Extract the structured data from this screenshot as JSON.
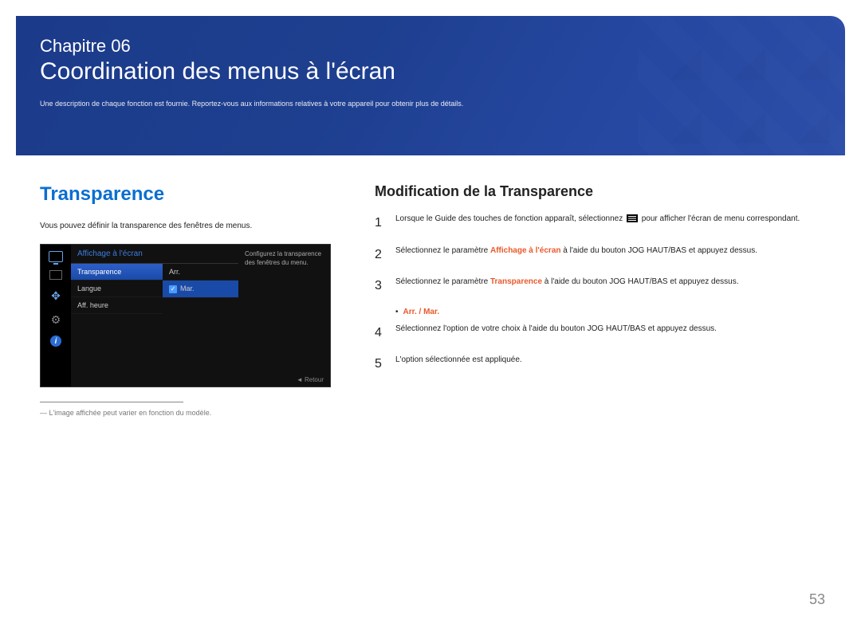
{
  "header": {
    "chapter_label": "Chapitre 06",
    "title": "Coordination des menus à l'écran",
    "desc": "Une description de chaque fonction est fournie. Reportez-vous aux informations relatives à votre appareil pour obtenir plus de détails."
  },
  "left": {
    "section_title": "Transparence",
    "section_desc": "Vous pouvez définir la transparence des fenêtres de menus.",
    "osd": {
      "head": "Affichage à l'écran",
      "items": [
        "Transparence",
        "Langue",
        "Aff. heure"
      ],
      "options": [
        "Arr.",
        "Mar."
      ],
      "info": "Configurez la transparence des fenêtres du menu.",
      "return": "Retour"
    },
    "footnote": "L'image affichée peut varier en fonction du modèle."
  },
  "right": {
    "sub_title": "Modification de la Transparence",
    "steps": [
      {
        "num": "1",
        "pre": "Lorsque le Guide des touches de fonction apparaît, sélectionnez ",
        "icon": true,
        "post": " pour afficher l'écran de menu correspondant."
      },
      {
        "num": "2",
        "pre": "Sélectionnez le paramètre ",
        "hl": "Affichage à l'écran",
        "post": " à l'aide du bouton JOG HAUT/BAS et appuyez dessus."
      },
      {
        "num": "3",
        "pre": "Sélectionnez le paramètre ",
        "hl": "Transparence",
        "post": " à l'aide du bouton JOG HAUT/BAS et appuyez dessus."
      }
    ],
    "bullet": "Arr. / Mar.",
    "steps2": [
      {
        "num": "4",
        "text": "Sélectionnez l'option de votre choix à l'aide du bouton JOG HAUT/BAS et appuyez dessus."
      },
      {
        "num": "5",
        "text": "L'option sélectionnée est appliquée."
      }
    ]
  },
  "page": "53"
}
